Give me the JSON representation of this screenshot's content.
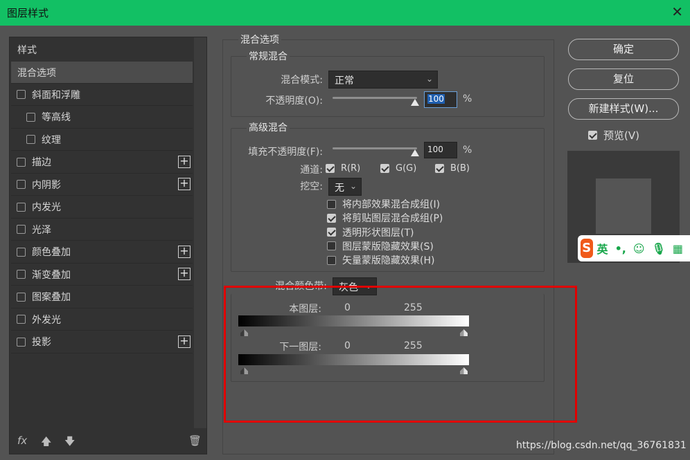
{
  "window": {
    "title": "图层样式",
    "close_glyph": "✕"
  },
  "styles_panel": {
    "header": "样式",
    "selected": "混合选项",
    "items": [
      {
        "label": "斜面和浮雕",
        "checked": false,
        "plus": false
      },
      {
        "label": "等高线",
        "checked": false,
        "plus": false,
        "indent": true
      },
      {
        "label": "纹理",
        "checked": false,
        "plus": false,
        "indent": true
      },
      {
        "label": "描边",
        "checked": false,
        "plus": true
      },
      {
        "label": "内阴影",
        "checked": false,
        "plus": true
      },
      {
        "label": "内发光",
        "checked": false,
        "plus": false
      },
      {
        "label": "光泽",
        "checked": false,
        "plus": false
      },
      {
        "label": "颜色叠加",
        "checked": false,
        "plus": true
      },
      {
        "label": "渐变叠加",
        "checked": false,
        "plus": true
      },
      {
        "label": "图案叠加",
        "checked": false,
        "plus": false
      },
      {
        "label": "外发光",
        "checked": false,
        "plus": false
      },
      {
        "label": "投影",
        "checked": false,
        "plus": true
      }
    ],
    "plus_glyph": "+",
    "footer": {
      "fx": "fx",
      "up": "🡅",
      "down": "🡇",
      "trash": "🗑"
    }
  },
  "blend_options": {
    "section_title": "混合选项",
    "general": {
      "title": "常规混合",
      "blend_mode_label": "混合模式:",
      "blend_mode_value": "正常",
      "opacity_label": "不透明度(O):",
      "opacity_value": "100",
      "opacity_unit": "%",
      "opacity_level": 1.0
    },
    "advanced": {
      "title": "高级混合",
      "fill_label": "填充不透明度(F):",
      "fill_value": "100",
      "fill_unit": "%",
      "fill_level": 1.0,
      "channels_label": "通道:",
      "channels": [
        {
          "label": "R(R)",
          "checked": true
        },
        {
          "label": "G(G)",
          "checked": true
        },
        {
          "label": "B(B)",
          "checked": true
        }
      ],
      "knockout_label": "挖空:",
      "knockout_value": "无",
      "options": [
        {
          "label": "将内部效果混合成组(I)",
          "checked": false
        },
        {
          "label": "将剪贴图层混合成组(P)",
          "checked": true
        },
        {
          "label": "透明形状图层(T)",
          "checked": true
        },
        {
          "label": "图层蒙版隐藏效果(S)",
          "checked": false
        },
        {
          "label": "矢量蒙版隐藏效果(H)",
          "checked": false
        }
      ]
    },
    "blend_if": {
      "label": "混合颜色带:",
      "value": "灰色",
      "this_layer_label": "本图层:",
      "this_layer_min": "0",
      "this_layer_max": "255",
      "underlying_label": "下一图层:",
      "underlying_min": "0",
      "underlying_max": "255"
    }
  },
  "buttons": {
    "ok": "确定",
    "reset": "复位",
    "new_style": "新建样式(W)...",
    "preview_label": "预览(V)",
    "preview_checked": true
  },
  "ime_bar": {
    "logo": "S",
    "lang": "英",
    "punct": "•,",
    "emoji": "☺",
    "mic": "🎙",
    "kbd": "▦"
  },
  "watermark": "https://blog.csdn.net/qq_36761831",
  "colors": {
    "titlebar": "#12c064",
    "highlight": "#e00000",
    "background": "#535353"
  }
}
